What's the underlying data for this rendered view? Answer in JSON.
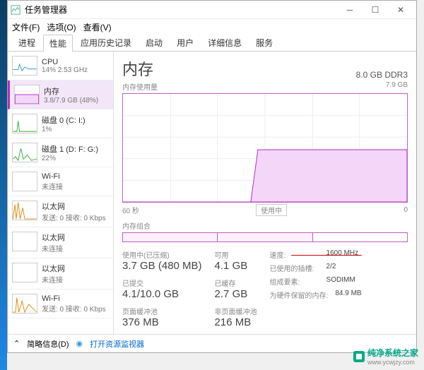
{
  "window": {
    "title": "任务管理器"
  },
  "menu": {
    "file": "文件(F)",
    "options": "选项(O)",
    "view": "查看(V)"
  },
  "tabs": {
    "processes": "进程",
    "performance": "性能",
    "history": "应用历史记录",
    "startup": "启动",
    "users": "用户",
    "details": "详细信息",
    "services": "服务"
  },
  "sidebar": {
    "items": [
      {
        "title": "CPU",
        "sub": "14% 2.53 GHz"
      },
      {
        "title": "内存",
        "sub": "3.8/7.9 GB (48%)"
      },
      {
        "title": "磁盘 0 (C: I:)",
        "sub": "1%"
      },
      {
        "title": "磁盘 1 (D: F: G:)",
        "sub": "22%"
      },
      {
        "title": "Wi-Fi",
        "sub": "未连接"
      },
      {
        "title": "以太网",
        "sub": "发送: 0 接收: 0 Kbps"
      },
      {
        "title": "以太网",
        "sub": "未连接"
      },
      {
        "title": "以太网",
        "sub": "未连接"
      },
      {
        "title": "Wi-Fi",
        "sub": "发送: 0 接收: 0 Kbps"
      }
    ]
  },
  "main": {
    "title": "内存",
    "right": "8.0 GB DDR3",
    "usage_label": "内存使用量",
    "usage_max": "7.9 GB",
    "x_left": "60 秒",
    "x_mid": "使用中",
    "x_right": "0",
    "slots_label": "内存组合",
    "stats": {
      "in_use_label": "使用中(已压缩)",
      "in_use": "3.7 GB (480 MB)",
      "avail_label": "可用",
      "avail": "4.1 GB",
      "committed_label": "已提交",
      "committed": "4.1/10.0 GB",
      "cached_label": "已缓存",
      "cached": "2.7 GB",
      "paged_label": "页面缓冲池",
      "paged": "376 MB",
      "nonpaged_label": "非页面缓冲池",
      "nonpaged": "216 MB"
    },
    "kv": {
      "speed_k": "速度:",
      "speed_v": "1600 MHz",
      "slots_k": "已使用的插槽:",
      "slots_v": "2/2",
      "form_k": "组成要素:",
      "form_v": "SODIMM",
      "reserved_k": "为硬件保留的内存:",
      "reserved_v": "84.9 MB"
    }
  },
  "footer": {
    "less": "简略信息(D)",
    "monitor": "打开资源监视器"
  },
  "watermark": {
    "name": "纯净系统之家",
    "url": "www.ycwjzy.com"
  },
  "chart_data": {
    "type": "area",
    "title": "内存使用量",
    "ylabel": "GB",
    "ylim": [
      0,
      7.9
    ],
    "x_seconds": [
      60,
      55,
      50,
      45,
      40,
      35,
      30,
      25,
      20,
      15,
      10,
      5,
      0
    ],
    "values": [
      0,
      0,
      0,
      0,
      0,
      0,
      3.8,
      3.8,
      3.8,
      3.8,
      3.8,
      3.8,
      3.8
    ]
  }
}
